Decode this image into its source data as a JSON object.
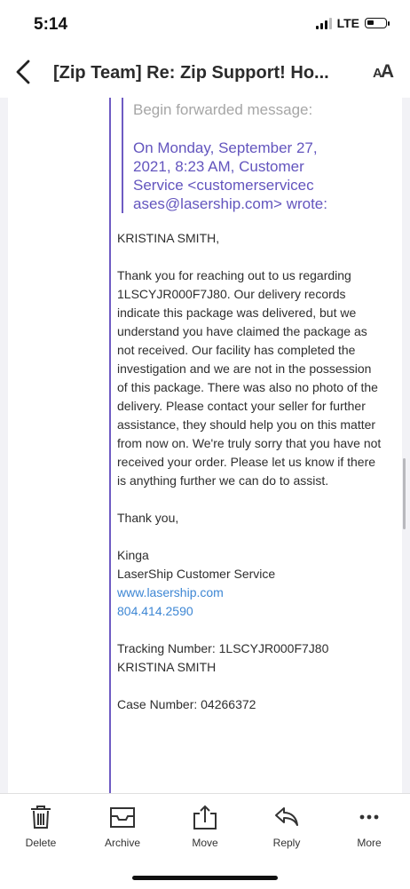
{
  "status_bar": {
    "time": "5:14",
    "network": "LTE",
    "battery_level": 0.4,
    "signal_bars": 3
  },
  "nav": {
    "title": "[Zip Team] Re: Zip Support! Ho...",
    "text_size_label_big": "A",
    "text_size_label_small": "A"
  },
  "message": {
    "forward_header": "Begin forwarded message:",
    "forward_meta": "On Monday, September 27, 2021, 8:23 AM, Customer Service <customerservicec ases@lasership.com> wrote:",
    "greeting": "KRISTINA SMITH,",
    "body": "Thank you for reaching out to us regarding 1LSCYJR000F7J80. Our delivery records indicate this package was delivered, but we understand you have claimed the package as not received. Our facility has completed the investigation and we are not in the possession of this package. There was also no photo of the delivery. Please contact your seller for further assistance, they should help you on this matter from now on. We're truly sorry that you have not received your order. Please let us know if there is anything further we can do to assist.",
    "closing": "Thank you,",
    "signature_name": "Kinga",
    "signature_company": "LaserShip Customer Service",
    "signature_link": "www.lasership.com",
    "signature_phone": "804.414.2590",
    "tracking_line": "Tracking Number: 1LSCYJR000F7J80",
    "tracking_name": "KRISTINA SMITH",
    "case_line": "Case Number: 04266372"
  },
  "toolbar": {
    "delete_label": "Delete",
    "archive_label": "Archive",
    "move_label": "Move",
    "reply_label": "Reply",
    "more_label": "More"
  },
  "colors": {
    "quote_bar": "#6e5bc3",
    "forward_meta": "#6355be",
    "link": "#3e87d4"
  }
}
